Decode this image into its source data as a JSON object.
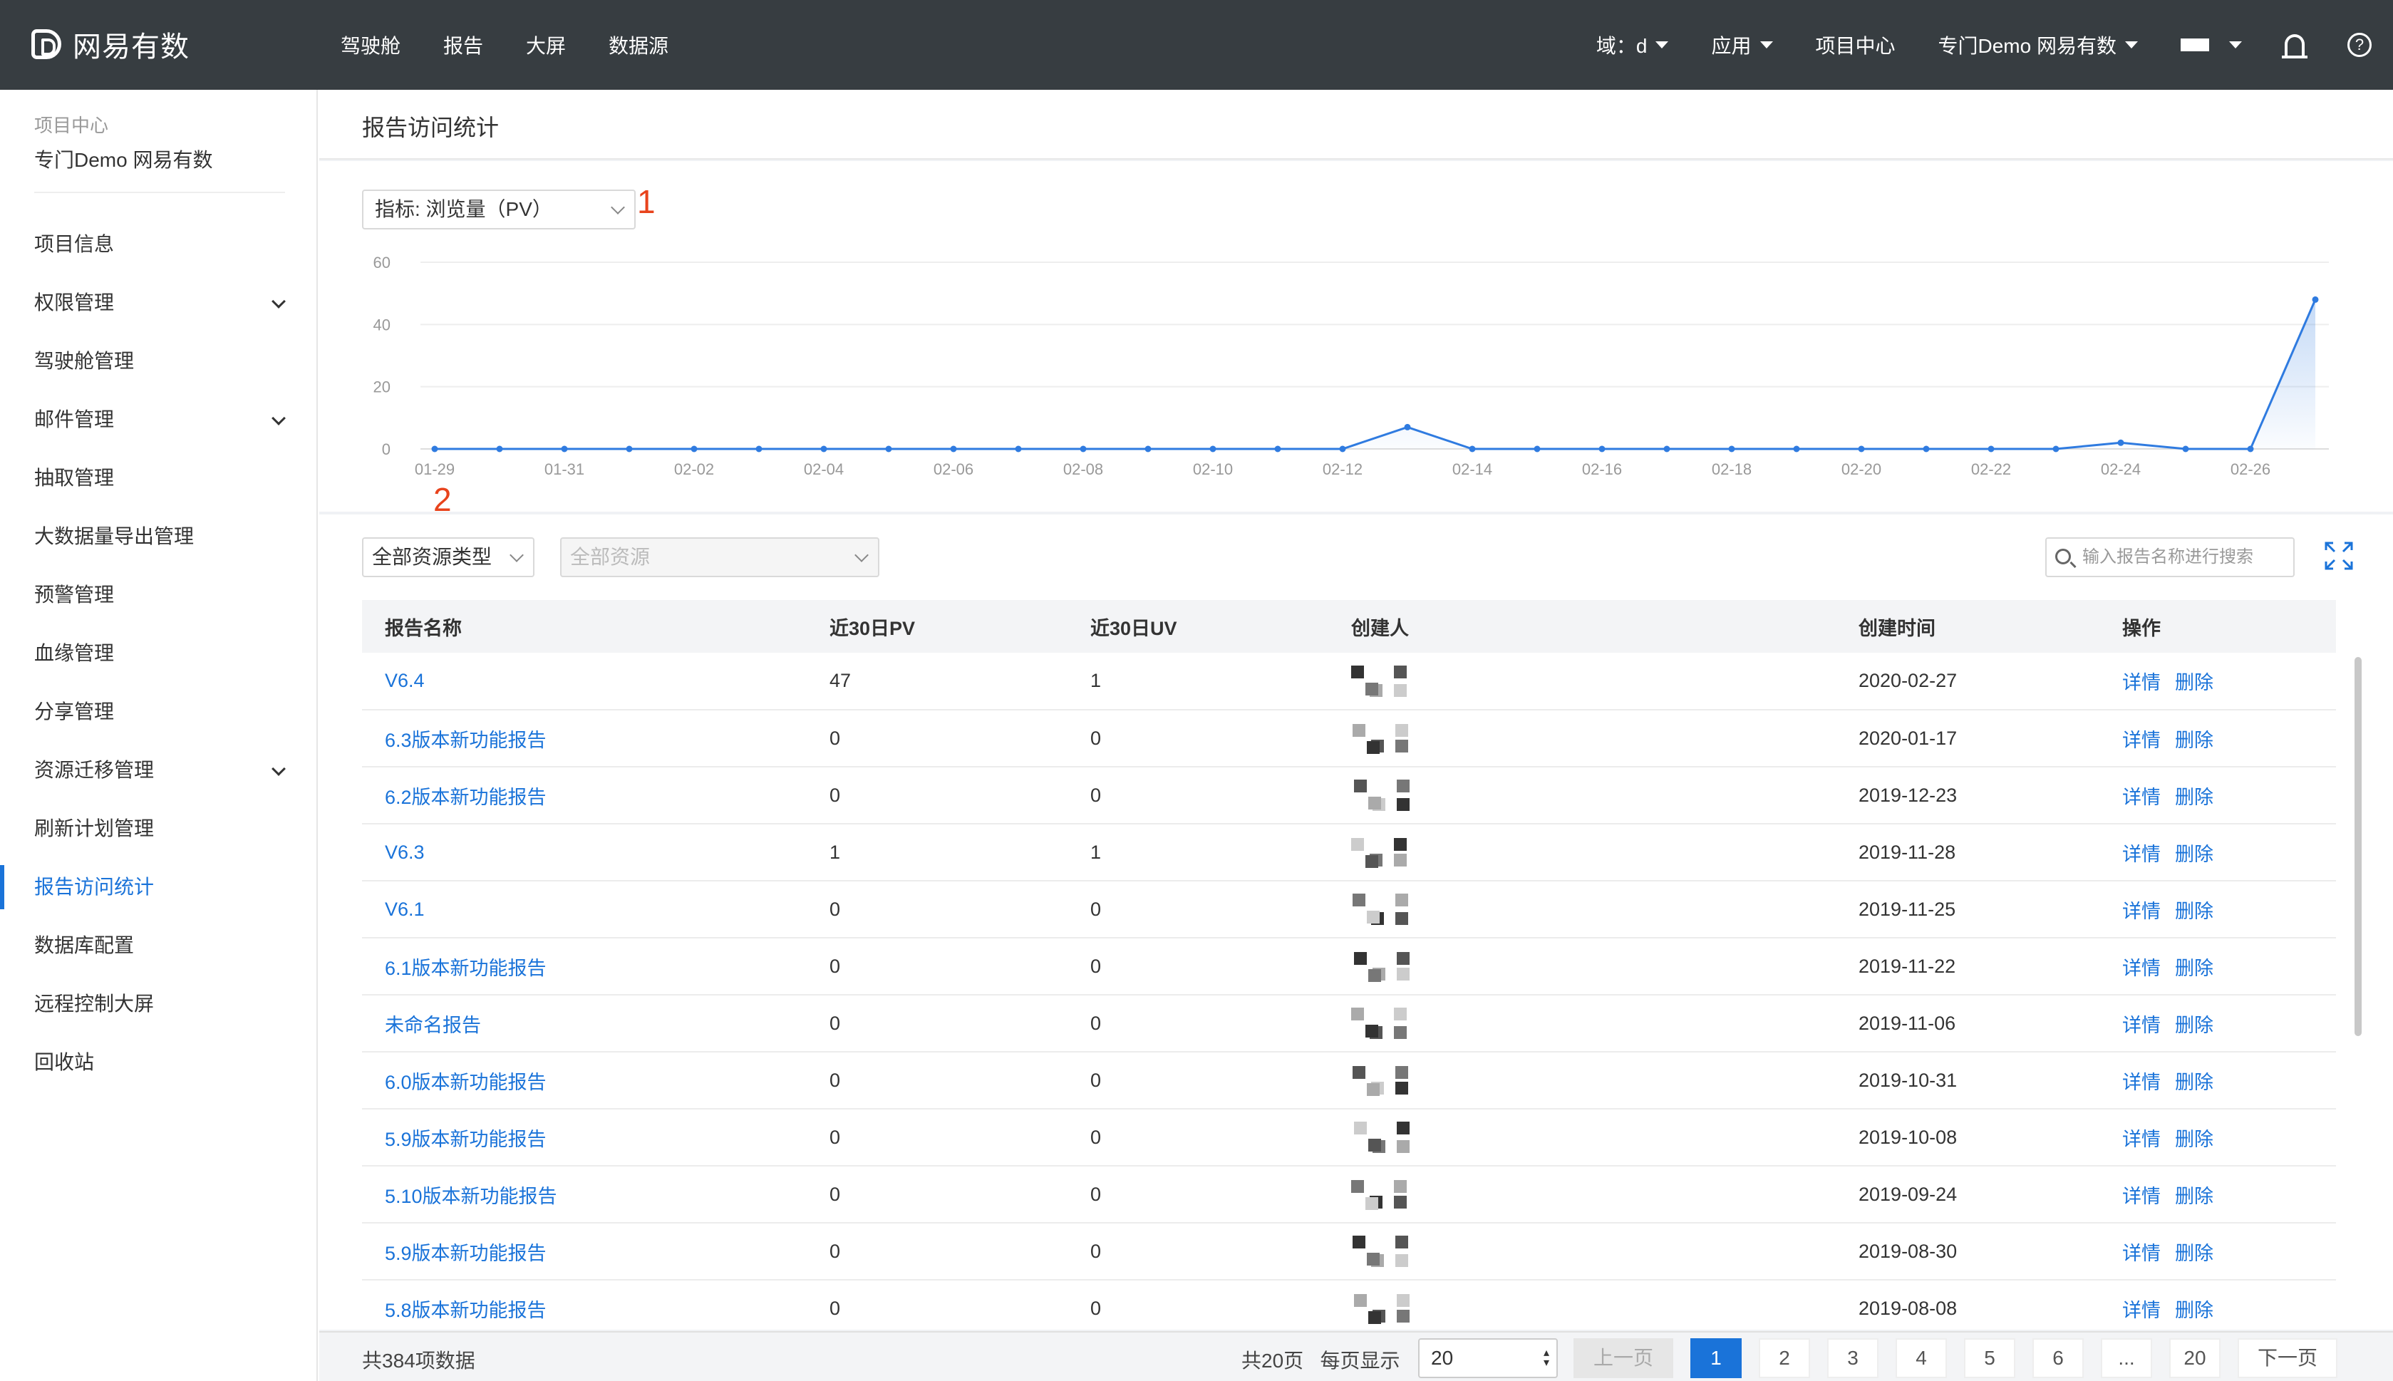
{
  "header": {
    "logo_text": "网易有数",
    "nav": [
      "驾驶舱",
      "报告",
      "大屏",
      "数据源"
    ],
    "domain_label": "域：d",
    "apps_label": "应用",
    "project_center": "项目中心",
    "project_name": "专门Demo 网易有数"
  },
  "sidebar": {
    "head_small": "项目中心",
    "head_big": "专门Demo 网易有数",
    "items": [
      {
        "label": "项目信息",
        "expandable": false
      },
      {
        "label": "权限管理",
        "expandable": true
      },
      {
        "label": "驾驶舱管理",
        "expandable": false
      },
      {
        "label": "邮件管理",
        "expandable": true
      },
      {
        "label": "抽取管理",
        "expandable": false
      },
      {
        "label": "大数据量导出管理",
        "expandable": false
      },
      {
        "label": "预警管理",
        "expandable": false
      },
      {
        "label": "血缘管理",
        "expandable": false
      },
      {
        "label": "分享管理",
        "expandable": false
      },
      {
        "label": "资源迁移管理",
        "expandable": true
      },
      {
        "label": "刷新计划管理",
        "expandable": false
      },
      {
        "label": "报告访问统计",
        "expandable": false,
        "active": true
      },
      {
        "label": "数据库配置",
        "expandable": false
      },
      {
        "label": "远程控制大屏",
        "expandable": false
      },
      {
        "label": "回收站",
        "expandable": false
      }
    ]
  },
  "page": {
    "title": "报告访问统计",
    "metric_select": "指标:  浏览量（PV）",
    "anno1": "1",
    "anno2": "2"
  },
  "chart_data": {
    "type": "area",
    "x": [
      "01-29",
      "01-30",
      "01-31",
      "02-01",
      "02-02",
      "02-03",
      "02-04",
      "02-05",
      "02-06",
      "02-07",
      "02-08",
      "02-09",
      "02-10",
      "02-11",
      "02-12",
      "02-13",
      "02-14",
      "02-15",
      "02-16",
      "02-17",
      "02-18",
      "02-19",
      "02-20",
      "02-21",
      "02-22",
      "02-23",
      "02-24",
      "02-25",
      "02-26",
      "02-27"
    ],
    "x_tick_labels": [
      "01-29",
      "01-31",
      "02-02",
      "02-04",
      "02-06",
      "02-08",
      "02-10",
      "02-12",
      "02-14",
      "02-16",
      "02-18",
      "02-20",
      "02-22",
      "02-24",
      "02-26"
    ],
    "values": [
      0,
      0,
      0,
      0,
      0,
      0,
      0,
      0,
      0,
      0,
      0,
      0,
      0,
      0,
      0,
      7,
      0,
      0,
      0,
      0,
      0,
      0,
      0,
      0,
      0,
      0,
      2,
      0,
      0,
      48
    ],
    "yticks": [
      0,
      20,
      40,
      60
    ],
    "ylim": [
      0,
      60
    ],
    "grid": true,
    "line_color": "#2f7be0"
  },
  "filters": {
    "resource_type": "全部资源类型",
    "resource": "全部资源",
    "search_placeholder": "输入报告名称进行搜索"
  },
  "table": {
    "columns": [
      "报告名称",
      "近30日PV",
      "近30日UV",
      "创建人",
      "创建时间",
      "操作"
    ],
    "rows": [
      {
        "name": "V6.4",
        "pv": "47",
        "uv": "1",
        "date": "2020-02-27"
      },
      {
        "name": "6.3版本新功能报告",
        "pv": "0",
        "uv": "0",
        "date": "2020-01-17"
      },
      {
        "name": "6.2版本新功能报告",
        "pv": "0",
        "uv": "0",
        "date": "2019-12-23"
      },
      {
        "name": "V6.3",
        "pv": "1",
        "uv": "1",
        "date": "2019-11-28"
      },
      {
        "name": "V6.1",
        "pv": "0",
        "uv": "0",
        "date": "2019-11-25"
      },
      {
        "name": "6.1版本新功能报告",
        "pv": "0",
        "uv": "0",
        "date": "2019-11-22"
      },
      {
        "name": "未命名报告",
        "pv": "0",
        "uv": "0",
        "date": "2019-11-06"
      },
      {
        "name": "6.0版本新功能报告",
        "pv": "0",
        "uv": "0",
        "date": "2019-10-31"
      },
      {
        "name": "5.9版本新功能报告",
        "pv": "0",
        "uv": "0",
        "date": "2019-10-08"
      },
      {
        "name": "5.10版本新功能报告",
        "pv": "0",
        "uv": "0",
        "date": "2019-09-24"
      },
      {
        "name": "5.9版本新功能报告",
        "pv": "0",
        "uv": "0",
        "date": "2019-08-30"
      },
      {
        "name": "5.8版本新功能报告",
        "pv": "0",
        "uv": "0",
        "date": "2019-08-08"
      }
    ],
    "op_detail": "详情",
    "op_delete": "删除"
  },
  "pager": {
    "total": "共384项数据",
    "pages_info": "共20页",
    "per_page_label": "每页显示",
    "per_page": "20",
    "prev": "上一页",
    "next": "下一页",
    "pages": [
      "1",
      "2",
      "3",
      "4",
      "5",
      "6",
      "...",
      "20"
    ],
    "current": "1"
  }
}
